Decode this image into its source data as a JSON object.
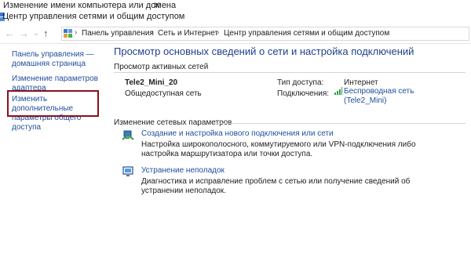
{
  "background_window": {
    "title": "Изменение имени компьютера или домена",
    "close": "✕"
  },
  "window": {
    "title": "Центр управления сетями и общим доступом"
  },
  "nav": {
    "back": "←",
    "forward": "→",
    "dropdown": "⌄",
    "up": "↑"
  },
  "address": {
    "crumbs": [
      "Панель управления",
      "Сеть и Интернет",
      "Центр управления сетями и общим доступом"
    ],
    "separator": "›"
  },
  "sidebar": {
    "items": [
      {
        "label": "Панель управления — домашняя страница"
      },
      {
        "label": "Изменение параметров адаптера"
      },
      {
        "label": "Изменить дополнительные параметры общего доступа"
      }
    ]
  },
  "main": {
    "title": "Просмотр основных сведений о сети и настройка подключений",
    "active_networks_header": "Просмотр активных сетей",
    "network": {
      "name": "Tele2_Mini_20",
      "type": "Общедоступная сеть",
      "access_label": "Тип доступа:",
      "access_value": "Интернет",
      "connections_label": "Подключения:",
      "connections_value": "Беспроводная сеть (Tele2_Mini)"
    },
    "change_header": "Изменение сетевых параметров",
    "tasks": [
      {
        "link": "Создание и настройка нового подключения или сети",
        "desc": "Настройка широкополосного, коммутируемого или VPN-подключения либо настройка маршрутизатора или точки доступа.",
        "icon": "new-connection-icon"
      },
      {
        "link": "Устранение неполадок",
        "desc": "Диагностика и исправление проблем с сетью или получение сведений об устранении неполадок.",
        "icon": "troubleshoot-icon"
      }
    ]
  },
  "colors": {
    "link": "#1f4d9e",
    "title": "#1f3f8f",
    "highlight": "#8b0f1c",
    "signal": "#2ea043"
  }
}
